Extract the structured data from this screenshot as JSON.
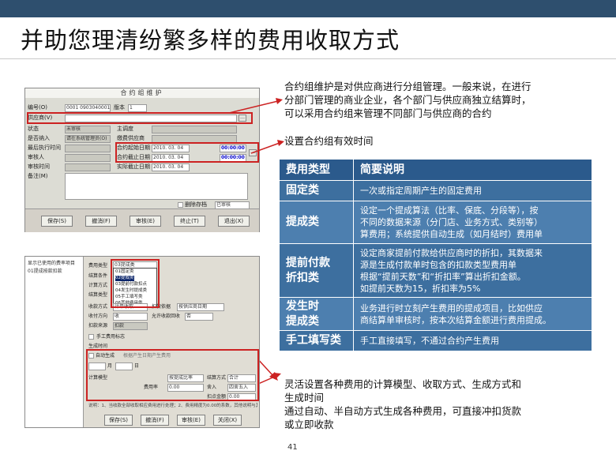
{
  "slide": {
    "title": "并助您理清纷繁多样的费用收取方式",
    "page_number": "41"
  },
  "screenshot1": {
    "title": "合约组维护",
    "labels": {
      "id": "编号(O)",
      "version": "版本",
      "supplier": "供应商(V)",
      "status": "状态",
      "whether_import": "是否纳入",
      "last_exec": "最后执行时间",
      "reviewer": "审核人",
      "review_time": "审核时间",
      "remark": "备注(M)",
      "owner": "主调度",
      "group_mode": "缴费供应商",
      "start_date": "合约起始日期",
      "end_date": "合约截止日期",
      "actual_end": "实际截止日期"
    },
    "values": {
      "id": "0001 0903040001",
      "version": "1",
      "status": "未审核",
      "whether_import": "请在系统管理员(O)",
      "start_date": "2010. 03. 04",
      "start_time": "00:00:00",
      "end_date": "2010. 03. 04",
      "end_time": "00:00:00",
      "actual_end": "2010. 03. 04"
    },
    "checkbox_label": "删除存档",
    "dropdown_value": "已审核",
    "buttons": [
      "保存(S)",
      "撤消(F)",
      "审核(E)",
      "终止(T)",
      "退出(X)"
    ]
  },
  "screenshot2": {
    "tree": [
      "显示已使用的费率项目",
      "01提成按款扣款"
    ],
    "labels": {
      "fee_type": "费用类型",
      "condition": "结算条件",
      "calc_method": "计算方式",
      "settle_type": "结算类型",
      "collect_method": "收款方式",
      "pay_direction": "收付方向",
      "deduct_source": "扣款来源",
      "manual_flag": "手工费用标志",
      "gen_time": "生成时间"
    },
    "dropdown_selected": "03提成类",
    "dropdown_options": [
      "01固定类",
      "02提成类",
      "03提前付款扣点",
      "04发生时提成类",
      "05手工填写类",
      "06其他费用类"
    ],
    "values": {
      "collect_method": "计单收取",
      "pay_direction": "收",
      "deduct_source": "扣款",
      "range_label": "扣款依据",
      "range_value": "按供应商日期",
      "first_collect": "允许收款回收",
      "first_value": "否",
      "month_label": "月",
      "day_label": "日",
      "auto_gen": "自动生成",
      "auto_note": "根据产生日期产生费用",
      "calc_model": "计算模型",
      "calc_model_value": "按提成比率",
      "collect_rate": "结算方式",
      "collect_rate_value": "合计",
      "tax_rate": "费用率",
      "tax_value": "0.00",
      "rounding": "舍入",
      "rounding_value": "四舍五入",
      "gen_amount": "扣点金额",
      "gen_amount_value": "0.00"
    },
    "footer_note": "说明：1、当收款全部收取相应费用进行处理；2、费用精度为0.00的系数，其他说明与其类同。",
    "buttons": [
      "保存(S)",
      "撤消(F)",
      "审核(E)",
      "关闭(X)"
    ]
  },
  "notes": {
    "top": [
      "合约组维护是对供应商进行分组管理。一般来说，在进行",
      "分部门管理的商业企业，各个部门与供应商独立结算时，",
      "可以采用合约组来管理不同部门与供应商的合约"
    ],
    "middle": "设置合约组有效时间",
    "bottom": [
      "灵活设置各种费用的计算模型、收取方式、生成方式和",
      "生成时间",
      "通过自动、半自动方式生成各种费用，可直接冲扣货款",
      "或立即收款"
    ]
  },
  "fee_table": {
    "headers": [
      "费用类型",
      "简要说明"
    ],
    "rows": [
      {
        "type": [
          "固定类"
        ],
        "desc": [
          "一次或指定周期产生的固定费用"
        ]
      },
      {
        "type": [
          "提成类"
        ],
        "desc": [
          "设定一个提成算法（比率、保底、分段等），按",
          "不同的数据来源（分门店、业务方式、类别等）",
          "算费用；系统提供自动生成（如月结时）费用单"
        ]
      },
      {
        "type": [
          "提前付款",
          "折扣类"
        ],
        "desc": [
          "设定商家提前付款给供应商时的折扣，其数据来",
          "源是生成付款单时包含的扣款类型费用单",
          "根据“提前天数”和“折扣率”算出折扣金额。",
          "如提前天数为15，折扣率为5%"
        ]
      },
      {
        "type": [
          "发生时",
          "提成类"
        ],
        "desc": [
          "业务进行时立刻产生费用的提成项目，比如供应",
          "商结算单审核时，按本次结算金额进行费用提成。"
        ]
      },
      {
        "type": [
          "手工填写类"
        ],
        "desc": [
          "手工直接填写，不通过合约产生费用"
        ]
      }
    ]
  },
  "colors": {
    "top_bar": "#2e4f6e",
    "table_header": "#2b5a8c",
    "table_row": "#3d6f9f",
    "highlight": "#cc2222"
  }
}
